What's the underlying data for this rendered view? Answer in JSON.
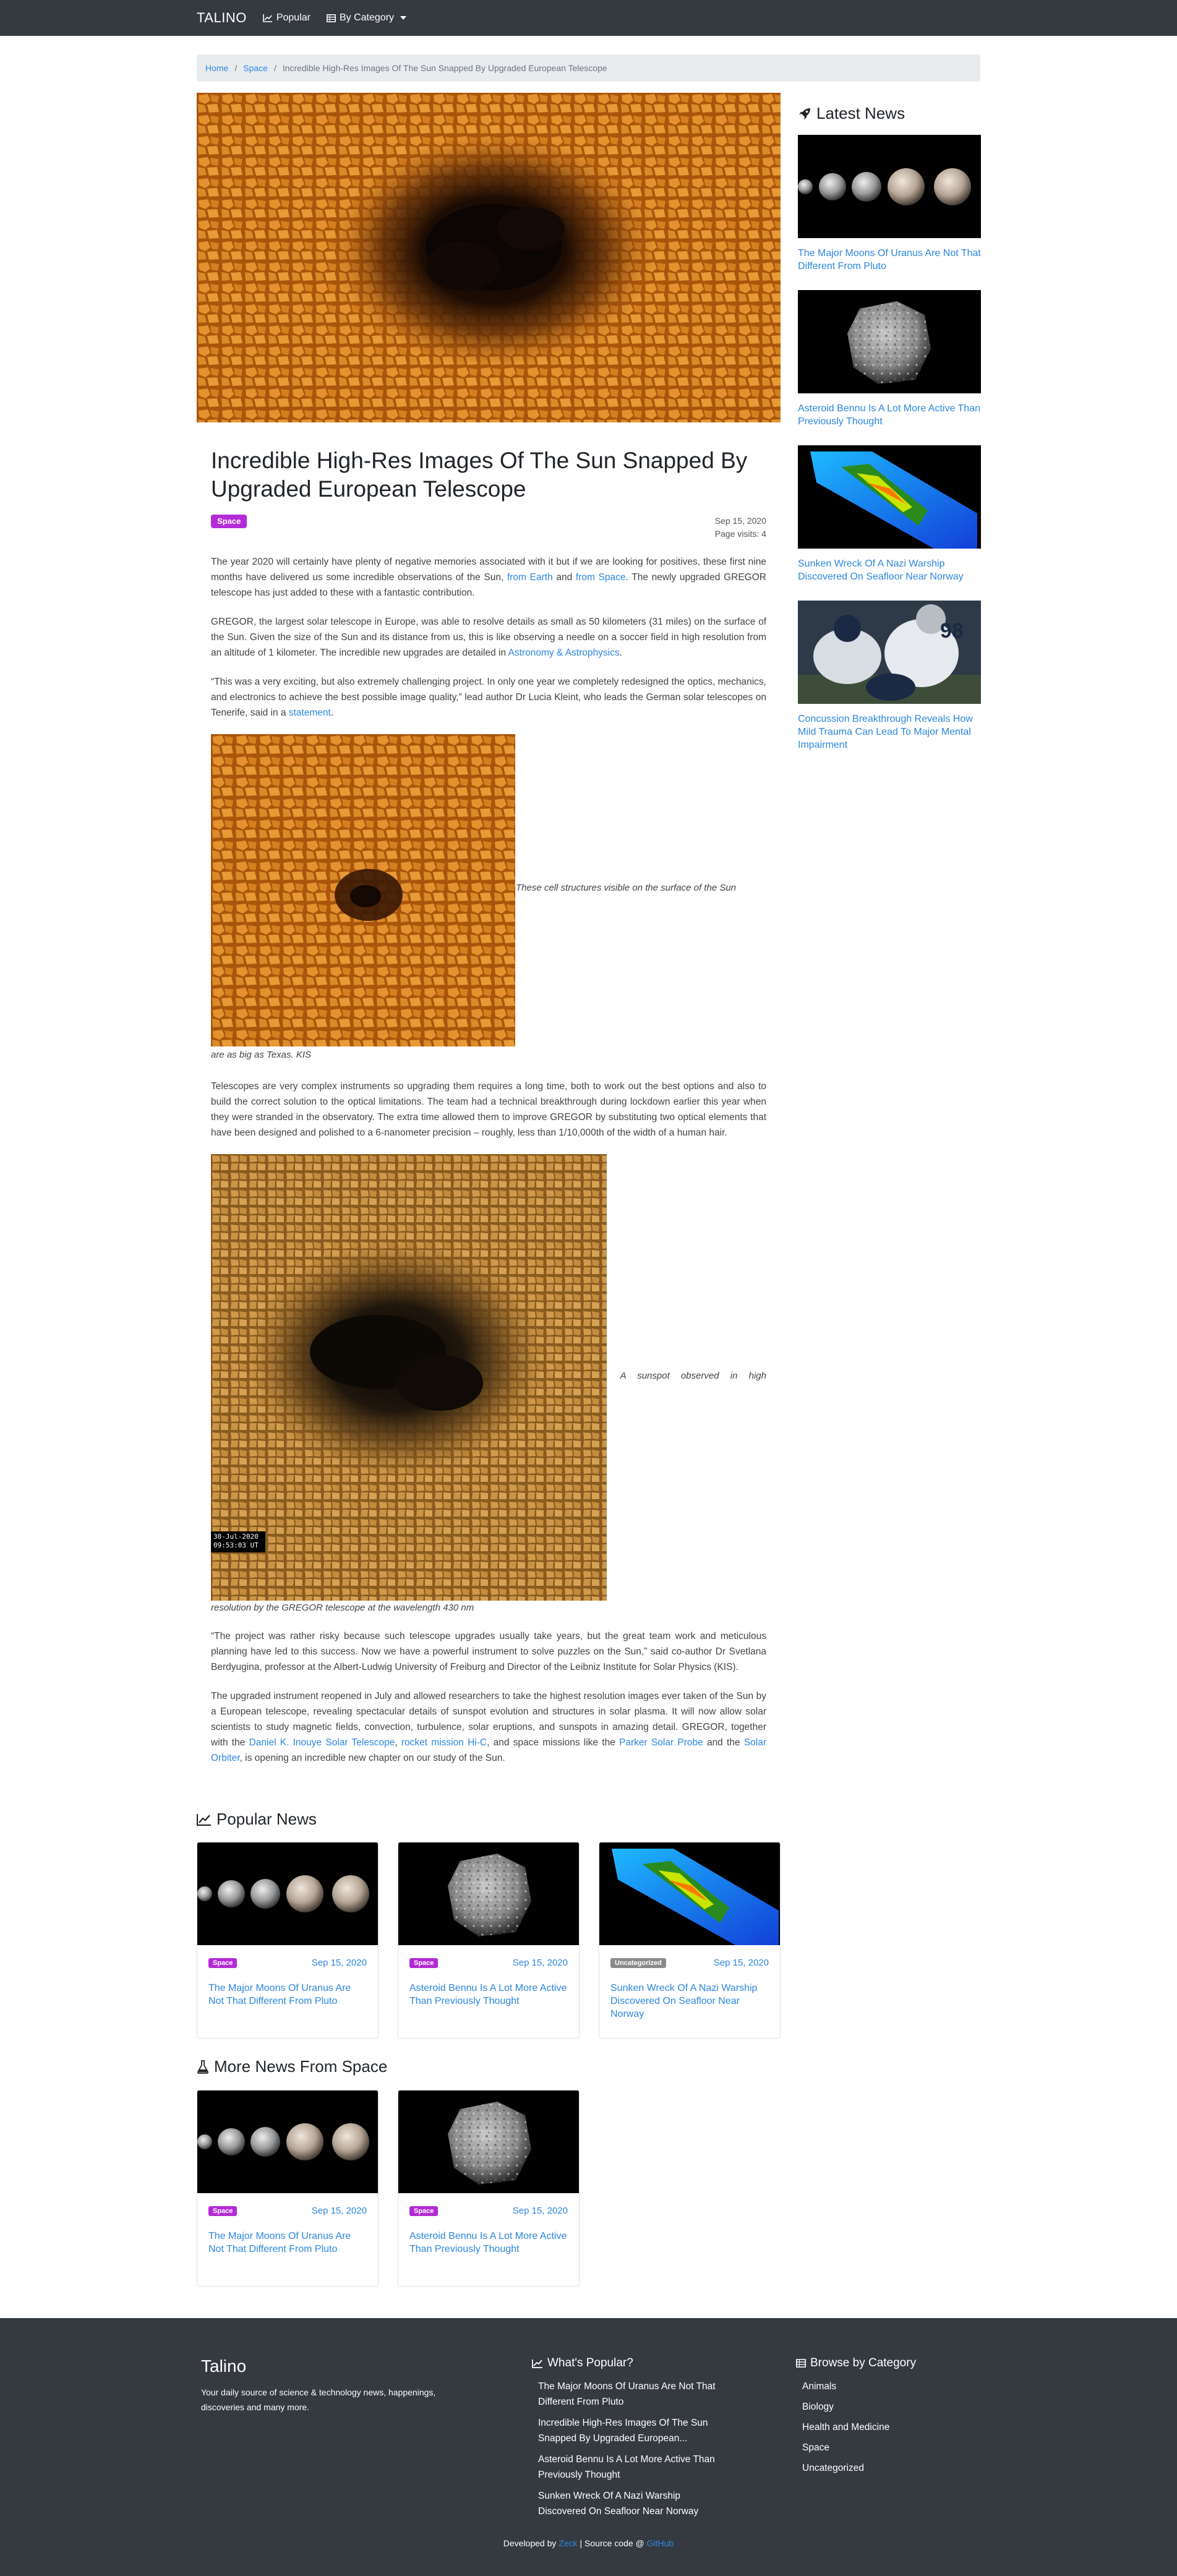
{
  "nav": {
    "brand": "TALINO",
    "popular": "Popular",
    "by_category": "By Category"
  },
  "breadcrumb": {
    "home": "Home",
    "category": "Space",
    "current": "Incredible High-Res Images Of The Sun Snapped By Upgraded European Telescope"
  },
  "article": {
    "title": "Incredible High-Res Images Of The Sun Snapped By Upgraded European Telescope",
    "category_badge": "Space",
    "date": "Sep 15, 2020",
    "visits": "Page visits: 4",
    "p1": {
      "a": "The year 2020 will certainly have plenty of negative memories associated with it but if we are looking for positives, these first nine months have delivered us some incredible observations of the Sun, ",
      "link1": "from Earth",
      "b": " and ",
      "link2": "from Space",
      "c": ". The newly upgraded GREGOR telescope has just added to these with a fantastic contribution."
    },
    "p2": {
      "a": "GREGOR, the largest solar telescope in Europe, was able to resolve details as small as 50 kilometers (31 miles) on the surface of the Sun. Given the size of the Sun and its distance from us, this is like observing a needle on a soccer field in high resolution from an altitude of 1 kilometer. The incredible new upgrades are detailed in ",
      "link": "Astronomy & Astrophysics",
      "b": "."
    },
    "p3": {
      "a": "“This was a very exciting, but also extremely challenging project. In only one year we completely redesigned the optics, mechanics, and electronics to achieve the best possible image quality,” lead author Dr Lucia Kleint, who leads the German solar telescopes on Tenerife, said in a ",
      "link": "statement",
      "b": "."
    },
    "fig1_caption_right": "These cell structures visible on the surface of the Sun",
    "fig1_caption_below": "are as big as Texas. KIS",
    "p4": "Telescopes are very complex instruments so upgrading them requires a long time, both to work out the best options and also to build the correct solution to the optical limitations. The team had a technical breakthrough during lockdown earlier this year when they were stranded in the observatory. The extra time allowed them to improve GREGOR by substituting two optical elements that have been designed and polished to a 6-nanometer precision – roughly, less than 1/10,000th of the width of a human hair.",
    "fig2_stamp_date": "30-Jul-2020",
    "fig2_stamp_time": "09:53:03 UT",
    "fig2_caption_right": "A sunspot observed in high",
    "fig2_caption_below": "resolution by the GREGOR telescope at the wavelength 430 nm",
    "p5": "“The project was rather risky because such telescope upgrades usually take years, but the great team work and meticulous planning have led to this success. Now we have a powerful instrument to solve puzzles on the Sun,” said co-author Dr Svetlana Berdyugina, professor at the Albert-Ludwig University of Freiburg and Director of the Leibniz Institute for Solar Physics (KIS).",
    "p6": {
      "a": "The upgraded instrument reopened in July and allowed researchers to take the highest resolution images ever taken of the Sun by a European telescope, revealing spectacular details of sunspot evolution and structures in solar plasma. It will now allow solar scientists to study magnetic fields, convection, turbulence, solar eruptions, and sunspots in amazing detail. GREGOR, together with the ",
      "link1": "Daniel K. Inouye Solar Telescope",
      "b": ", ",
      "link2": "rocket mission Hi-C",
      "c": ", and space missions like the ",
      "link3": "Parker Solar Probe",
      "d": " and the ",
      "link4": "Solar Orbiter",
      "e": ", is opening an incredible new chapter on our study of the Sun."
    }
  },
  "sidebar": {
    "title": "Latest News",
    "items": [
      {
        "title": "The Major Moons Of Uranus Are Not That Different From Pluto"
      },
      {
        "title": "Asteroid Bennu Is A Lot More Active Than Previously Thought"
      },
      {
        "title": "Sunken Wreck Of A Nazi Warship Discovered On Seafloor Near Norway"
      },
      {
        "title": "Concussion Breakthrough Reveals How Mild Trauma Can Lead To Major Mental Impairment"
      }
    ]
  },
  "popular": {
    "title": "Popular News",
    "cards": [
      {
        "badge": "Space",
        "date": "Sep 15, 2020",
        "title": "The Major Moons Of Uranus Are Not That Different From Pluto",
        "badge_color": "#b32bd6"
      },
      {
        "badge": "Space",
        "date": "Sep 15, 2020",
        "title": "Asteroid Bennu Is A Lot More Active Than Previously Thought",
        "badge_color": "#b32bd6"
      },
      {
        "badge": "Uncategorized",
        "date": "Sep 15, 2020",
        "title": "Sunken Wreck Of A Nazi Warship Discovered On Seafloor Near Norway",
        "badge_color": "#8a8a8a"
      }
    ]
  },
  "more": {
    "title": "More News From Space",
    "cards": [
      {
        "badge": "Space",
        "date": "Sep 15, 2020",
        "title": "The Major Moons Of Uranus Are Not That Different From Pluto"
      },
      {
        "badge": "Space",
        "date": "Sep 15, 2020",
        "title": "Asteroid Bennu Is A Lot More Active Than Previously Thought"
      }
    ]
  },
  "footer": {
    "brand": "Talino",
    "description": "Your daily source of science & technology news, happenings, discoveries and many more.",
    "popular_head": "What's Popular?",
    "popular_items": [
      "The Major Moons Of Uranus Are Not That Different From Pluto",
      "Incredible High-Res Images Of The Sun Snapped By Upgraded European...",
      "Asteroid Bennu Is A Lot More Active Than Previously Thought",
      "Sunken Wreck Of A Nazi Warship Discovered On Seafloor Near Norway"
    ],
    "category_head": "Browse by Category",
    "categories": [
      "Animals",
      "Biology",
      "Health and Medicine",
      "Space",
      "Uncategorized"
    ],
    "credit_a": "Developed by ",
    "credit_link1": "Zeck",
    "credit_b": " | Source code @ ",
    "credit_link2": "GitHub"
  },
  "colors": {
    "navbar": "#343a40",
    "link": "#2e86de",
    "space_badge": "#b32bd6",
    "uncategorized_badge": "#8a8a8a"
  }
}
